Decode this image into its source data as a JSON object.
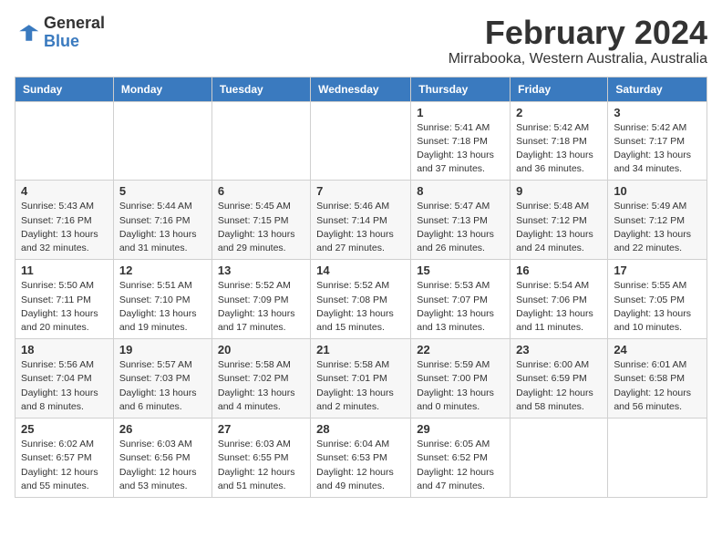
{
  "logo": {
    "text_general": "General",
    "text_blue": "Blue"
  },
  "title": "February 2024",
  "subtitle": "Mirrabooka, Western Australia, Australia",
  "days_of_week": [
    "Sunday",
    "Monday",
    "Tuesday",
    "Wednesday",
    "Thursday",
    "Friday",
    "Saturday"
  ],
  "weeks": [
    [
      {
        "day": "",
        "info": ""
      },
      {
        "day": "",
        "info": ""
      },
      {
        "day": "",
        "info": ""
      },
      {
        "day": "",
        "info": ""
      },
      {
        "day": "1",
        "info": "Sunrise: 5:41 AM\nSunset: 7:18 PM\nDaylight: 13 hours\nand 37 minutes."
      },
      {
        "day": "2",
        "info": "Sunrise: 5:42 AM\nSunset: 7:18 PM\nDaylight: 13 hours\nand 36 minutes."
      },
      {
        "day": "3",
        "info": "Sunrise: 5:42 AM\nSunset: 7:17 PM\nDaylight: 13 hours\nand 34 minutes."
      }
    ],
    [
      {
        "day": "4",
        "info": "Sunrise: 5:43 AM\nSunset: 7:16 PM\nDaylight: 13 hours\nand 32 minutes."
      },
      {
        "day": "5",
        "info": "Sunrise: 5:44 AM\nSunset: 7:16 PM\nDaylight: 13 hours\nand 31 minutes."
      },
      {
        "day": "6",
        "info": "Sunrise: 5:45 AM\nSunset: 7:15 PM\nDaylight: 13 hours\nand 29 minutes."
      },
      {
        "day": "7",
        "info": "Sunrise: 5:46 AM\nSunset: 7:14 PM\nDaylight: 13 hours\nand 27 minutes."
      },
      {
        "day": "8",
        "info": "Sunrise: 5:47 AM\nSunset: 7:13 PM\nDaylight: 13 hours\nand 26 minutes."
      },
      {
        "day": "9",
        "info": "Sunrise: 5:48 AM\nSunset: 7:12 PM\nDaylight: 13 hours\nand 24 minutes."
      },
      {
        "day": "10",
        "info": "Sunrise: 5:49 AM\nSunset: 7:12 PM\nDaylight: 13 hours\nand 22 minutes."
      }
    ],
    [
      {
        "day": "11",
        "info": "Sunrise: 5:50 AM\nSunset: 7:11 PM\nDaylight: 13 hours\nand 20 minutes."
      },
      {
        "day": "12",
        "info": "Sunrise: 5:51 AM\nSunset: 7:10 PM\nDaylight: 13 hours\nand 19 minutes."
      },
      {
        "day": "13",
        "info": "Sunrise: 5:52 AM\nSunset: 7:09 PM\nDaylight: 13 hours\nand 17 minutes."
      },
      {
        "day": "14",
        "info": "Sunrise: 5:52 AM\nSunset: 7:08 PM\nDaylight: 13 hours\nand 15 minutes."
      },
      {
        "day": "15",
        "info": "Sunrise: 5:53 AM\nSunset: 7:07 PM\nDaylight: 13 hours\nand 13 minutes."
      },
      {
        "day": "16",
        "info": "Sunrise: 5:54 AM\nSunset: 7:06 PM\nDaylight: 13 hours\nand 11 minutes."
      },
      {
        "day": "17",
        "info": "Sunrise: 5:55 AM\nSunset: 7:05 PM\nDaylight: 13 hours\nand 10 minutes."
      }
    ],
    [
      {
        "day": "18",
        "info": "Sunrise: 5:56 AM\nSunset: 7:04 PM\nDaylight: 13 hours\nand 8 minutes."
      },
      {
        "day": "19",
        "info": "Sunrise: 5:57 AM\nSunset: 7:03 PM\nDaylight: 13 hours\nand 6 minutes."
      },
      {
        "day": "20",
        "info": "Sunrise: 5:58 AM\nSunset: 7:02 PM\nDaylight: 13 hours\nand 4 minutes."
      },
      {
        "day": "21",
        "info": "Sunrise: 5:58 AM\nSunset: 7:01 PM\nDaylight: 13 hours\nand 2 minutes."
      },
      {
        "day": "22",
        "info": "Sunrise: 5:59 AM\nSunset: 7:00 PM\nDaylight: 13 hours\nand 0 minutes."
      },
      {
        "day": "23",
        "info": "Sunrise: 6:00 AM\nSunset: 6:59 PM\nDaylight: 12 hours\nand 58 minutes."
      },
      {
        "day": "24",
        "info": "Sunrise: 6:01 AM\nSunset: 6:58 PM\nDaylight: 12 hours\nand 56 minutes."
      }
    ],
    [
      {
        "day": "25",
        "info": "Sunrise: 6:02 AM\nSunset: 6:57 PM\nDaylight: 12 hours\nand 55 minutes."
      },
      {
        "day": "26",
        "info": "Sunrise: 6:03 AM\nSunset: 6:56 PM\nDaylight: 12 hours\nand 53 minutes."
      },
      {
        "day": "27",
        "info": "Sunrise: 6:03 AM\nSunset: 6:55 PM\nDaylight: 12 hours\nand 51 minutes."
      },
      {
        "day": "28",
        "info": "Sunrise: 6:04 AM\nSunset: 6:53 PM\nDaylight: 12 hours\nand 49 minutes."
      },
      {
        "day": "29",
        "info": "Sunrise: 6:05 AM\nSunset: 6:52 PM\nDaylight: 12 hours\nand 47 minutes."
      },
      {
        "day": "",
        "info": ""
      },
      {
        "day": "",
        "info": ""
      }
    ]
  ]
}
